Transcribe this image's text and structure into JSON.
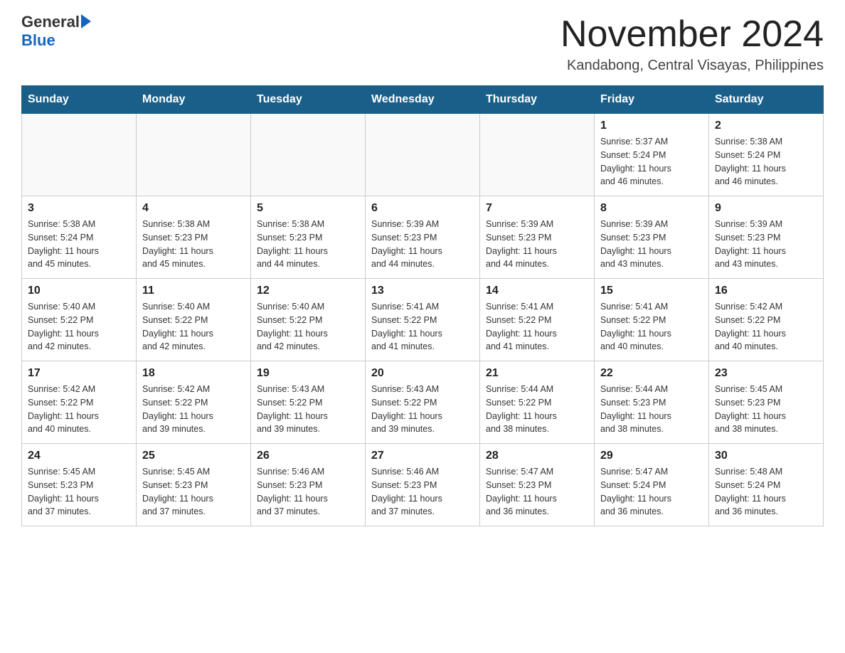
{
  "logo": {
    "general": "General",
    "blue": "Blue"
  },
  "title": "November 2024",
  "subtitle": "Kandabong, Central Visayas, Philippines",
  "headers": [
    "Sunday",
    "Monday",
    "Tuesday",
    "Wednesday",
    "Thursday",
    "Friday",
    "Saturday"
  ],
  "weeks": [
    [
      {
        "day": "",
        "info": ""
      },
      {
        "day": "",
        "info": ""
      },
      {
        "day": "",
        "info": ""
      },
      {
        "day": "",
        "info": ""
      },
      {
        "day": "",
        "info": ""
      },
      {
        "day": "1",
        "info": "Sunrise: 5:37 AM\nSunset: 5:24 PM\nDaylight: 11 hours\nand 46 minutes."
      },
      {
        "day": "2",
        "info": "Sunrise: 5:38 AM\nSunset: 5:24 PM\nDaylight: 11 hours\nand 46 minutes."
      }
    ],
    [
      {
        "day": "3",
        "info": "Sunrise: 5:38 AM\nSunset: 5:24 PM\nDaylight: 11 hours\nand 45 minutes."
      },
      {
        "day": "4",
        "info": "Sunrise: 5:38 AM\nSunset: 5:23 PM\nDaylight: 11 hours\nand 45 minutes."
      },
      {
        "day": "5",
        "info": "Sunrise: 5:38 AM\nSunset: 5:23 PM\nDaylight: 11 hours\nand 44 minutes."
      },
      {
        "day": "6",
        "info": "Sunrise: 5:39 AM\nSunset: 5:23 PM\nDaylight: 11 hours\nand 44 minutes."
      },
      {
        "day": "7",
        "info": "Sunrise: 5:39 AM\nSunset: 5:23 PM\nDaylight: 11 hours\nand 44 minutes."
      },
      {
        "day": "8",
        "info": "Sunrise: 5:39 AM\nSunset: 5:23 PM\nDaylight: 11 hours\nand 43 minutes."
      },
      {
        "day": "9",
        "info": "Sunrise: 5:39 AM\nSunset: 5:23 PM\nDaylight: 11 hours\nand 43 minutes."
      }
    ],
    [
      {
        "day": "10",
        "info": "Sunrise: 5:40 AM\nSunset: 5:22 PM\nDaylight: 11 hours\nand 42 minutes."
      },
      {
        "day": "11",
        "info": "Sunrise: 5:40 AM\nSunset: 5:22 PM\nDaylight: 11 hours\nand 42 minutes."
      },
      {
        "day": "12",
        "info": "Sunrise: 5:40 AM\nSunset: 5:22 PM\nDaylight: 11 hours\nand 42 minutes."
      },
      {
        "day": "13",
        "info": "Sunrise: 5:41 AM\nSunset: 5:22 PM\nDaylight: 11 hours\nand 41 minutes."
      },
      {
        "day": "14",
        "info": "Sunrise: 5:41 AM\nSunset: 5:22 PM\nDaylight: 11 hours\nand 41 minutes."
      },
      {
        "day": "15",
        "info": "Sunrise: 5:41 AM\nSunset: 5:22 PM\nDaylight: 11 hours\nand 40 minutes."
      },
      {
        "day": "16",
        "info": "Sunrise: 5:42 AM\nSunset: 5:22 PM\nDaylight: 11 hours\nand 40 minutes."
      }
    ],
    [
      {
        "day": "17",
        "info": "Sunrise: 5:42 AM\nSunset: 5:22 PM\nDaylight: 11 hours\nand 40 minutes."
      },
      {
        "day": "18",
        "info": "Sunrise: 5:42 AM\nSunset: 5:22 PM\nDaylight: 11 hours\nand 39 minutes."
      },
      {
        "day": "19",
        "info": "Sunrise: 5:43 AM\nSunset: 5:22 PM\nDaylight: 11 hours\nand 39 minutes."
      },
      {
        "day": "20",
        "info": "Sunrise: 5:43 AM\nSunset: 5:22 PM\nDaylight: 11 hours\nand 39 minutes."
      },
      {
        "day": "21",
        "info": "Sunrise: 5:44 AM\nSunset: 5:22 PM\nDaylight: 11 hours\nand 38 minutes."
      },
      {
        "day": "22",
        "info": "Sunrise: 5:44 AM\nSunset: 5:23 PM\nDaylight: 11 hours\nand 38 minutes."
      },
      {
        "day": "23",
        "info": "Sunrise: 5:45 AM\nSunset: 5:23 PM\nDaylight: 11 hours\nand 38 minutes."
      }
    ],
    [
      {
        "day": "24",
        "info": "Sunrise: 5:45 AM\nSunset: 5:23 PM\nDaylight: 11 hours\nand 37 minutes."
      },
      {
        "day": "25",
        "info": "Sunrise: 5:45 AM\nSunset: 5:23 PM\nDaylight: 11 hours\nand 37 minutes."
      },
      {
        "day": "26",
        "info": "Sunrise: 5:46 AM\nSunset: 5:23 PM\nDaylight: 11 hours\nand 37 minutes."
      },
      {
        "day": "27",
        "info": "Sunrise: 5:46 AM\nSunset: 5:23 PM\nDaylight: 11 hours\nand 37 minutes."
      },
      {
        "day": "28",
        "info": "Sunrise: 5:47 AM\nSunset: 5:23 PM\nDaylight: 11 hours\nand 36 minutes."
      },
      {
        "day": "29",
        "info": "Sunrise: 5:47 AM\nSunset: 5:24 PM\nDaylight: 11 hours\nand 36 minutes."
      },
      {
        "day": "30",
        "info": "Sunrise: 5:48 AM\nSunset: 5:24 PM\nDaylight: 11 hours\nand 36 minutes."
      }
    ]
  ]
}
